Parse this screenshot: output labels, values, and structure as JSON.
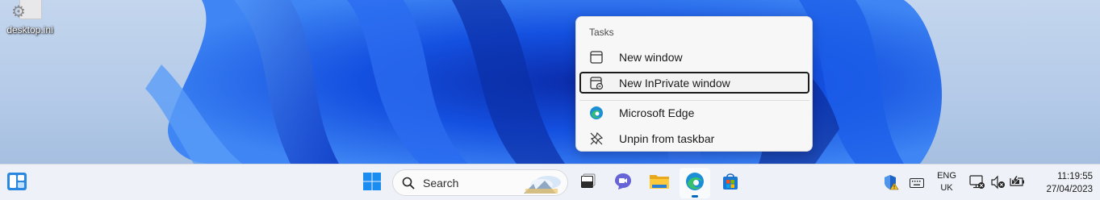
{
  "desktop": {
    "icons": [
      {
        "label": "desktop.ini",
        "icon": "settings-file-icon"
      }
    ]
  },
  "jumplist": {
    "header": "Tasks",
    "items": [
      {
        "label": "New window",
        "icon": "window-icon"
      },
      {
        "label": "New InPrivate window",
        "icon": "inprivate-icon",
        "focused": true
      },
      {
        "label": "Microsoft Edge",
        "icon": "edge-icon"
      },
      {
        "label": "Unpin from taskbar",
        "icon": "unpin-icon"
      }
    ]
  },
  "taskbar": {
    "left": {
      "icon": "widgets-icon"
    },
    "pinned": [
      {
        "name": "start",
        "icon": "windows-logo-icon"
      },
      {
        "name": "task-view",
        "icon": "task-view-icon"
      },
      {
        "name": "teams-chat",
        "icon": "chat-icon"
      },
      {
        "name": "file-explorer",
        "icon": "folder-icon"
      },
      {
        "name": "microsoft-edge",
        "icon": "edge-icon",
        "active": true
      },
      {
        "name": "microsoft-store",
        "icon": "store-icon"
      }
    ],
    "search": {
      "placeholder": "Search"
    },
    "tray": {
      "language_top": "ENG",
      "language_bottom": "UK",
      "time": "11:19:55",
      "date": "27/04/2023",
      "icons": [
        "security-warning-icon",
        "keyboard-icon",
        "network-icon",
        "volume-muted-icon",
        "battery-icon"
      ]
    }
  },
  "colors": {
    "accent": "#0067c0",
    "taskbar": "#eef1f7",
    "wallpaper": "#1f5ee8"
  }
}
